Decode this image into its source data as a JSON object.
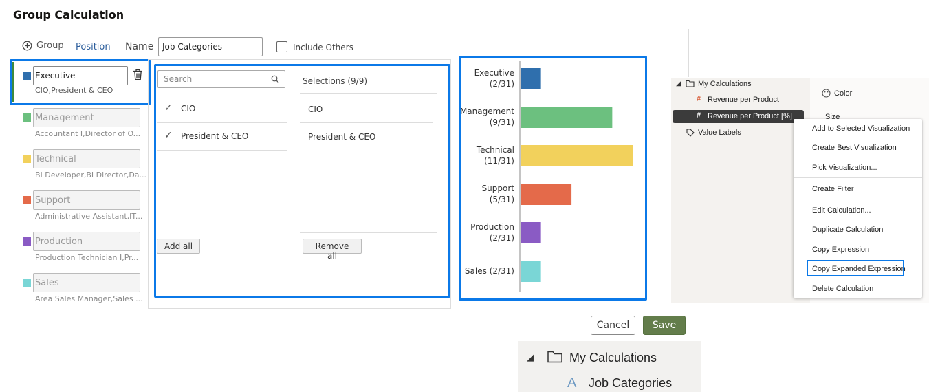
{
  "dialog": {
    "title": "Group Calculation",
    "group_btn": "Group",
    "position_btn": "Position",
    "name_label": "Name",
    "name_value": "Job Categories",
    "include_others": "Include Others",
    "cancel": "Cancel",
    "save": "Save"
  },
  "groups": [
    {
      "name": "Executive",
      "members": "CIO,President & CEO",
      "color": "#2f6fad"
    },
    {
      "name": "Management",
      "members": "Accountant I,Director of O...",
      "color": "#6cc07f"
    },
    {
      "name": "Technical",
      "members": "BI Developer,BI Director,Da...",
      "color": "#f2d15c"
    },
    {
      "name": "Support",
      "members": "Administrative Assistant,IT...",
      "color": "#e46a4a"
    },
    {
      "name": "Production",
      "members": "Production Technician I,Pr...",
      "color": "#8a5bc4"
    },
    {
      "name": "Sales",
      "members": "Area Sales Manager,Sales ...",
      "color": "#7ad6d6"
    }
  ],
  "picker": {
    "search_placeholder": "Search",
    "options": [
      "CIO",
      "President & CEO"
    ],
    "selections_header": "Selections (9/9)",
    "selections": [
      "CIO",
      "President & CEO"
    ],
    "add_all": "Add all",
    "remove_all": "Remove all"
  },
  "chart_data": {
    "type": "bar",
    "orientation": "horizontal",
    "categories": [
      "Executive (2/31)",
      "Management (9/31)",
      "Technical (11/31)",
      "Support (5/31)",
      "Production (2/31)",
      "Sales (2/31)"
    ],
    "values": [
      2,
      9,
      11,
      5,
      2,
      2
    ],
    "colors": [
      "#2f6fad",
      "#6cc07f",
      "#f2d15c",
      "#e46a4a",
      "#8a5bc4",
      "#7ad6d6"
    ],
    "max": 11
  },
  "chart_labels": [
    [
      "Executive",
      "(2/31)"
    ],
    [
      "Management",
      "(9/31)"
    ],
    [
      "Technical",
      "(11/31)"
    ],
    [
      "Support",
      "(5/31)"
    ],
    [
      "Production",
      "(2/31)"
    ],
    [
      "Sales (2/31)",
      ""
    ]
  ],
  "tree": {
    "folder": "My Calculations",
    "item1": "Revenue per Product",
    "item2": "Revenue per Product [%]",
    "item3": "Value Labels",
    "color": "Color",
    "size": "Size"
  },
  "context_menu": [
    "Add to Selected Visualization",
    "Create Best Visualization",
    "Pick Visualization...",
    "Create Filter",
    "Edit Calculation...",
    "Duplicate Calculation",
    "Copy Expression",
    "Copy Expanded Expression",
    "Delete Calculation"
  ],
  "bottom_tree": {
    "folder": "My Calculations",
    "item": "Job Categories"
  }
}
